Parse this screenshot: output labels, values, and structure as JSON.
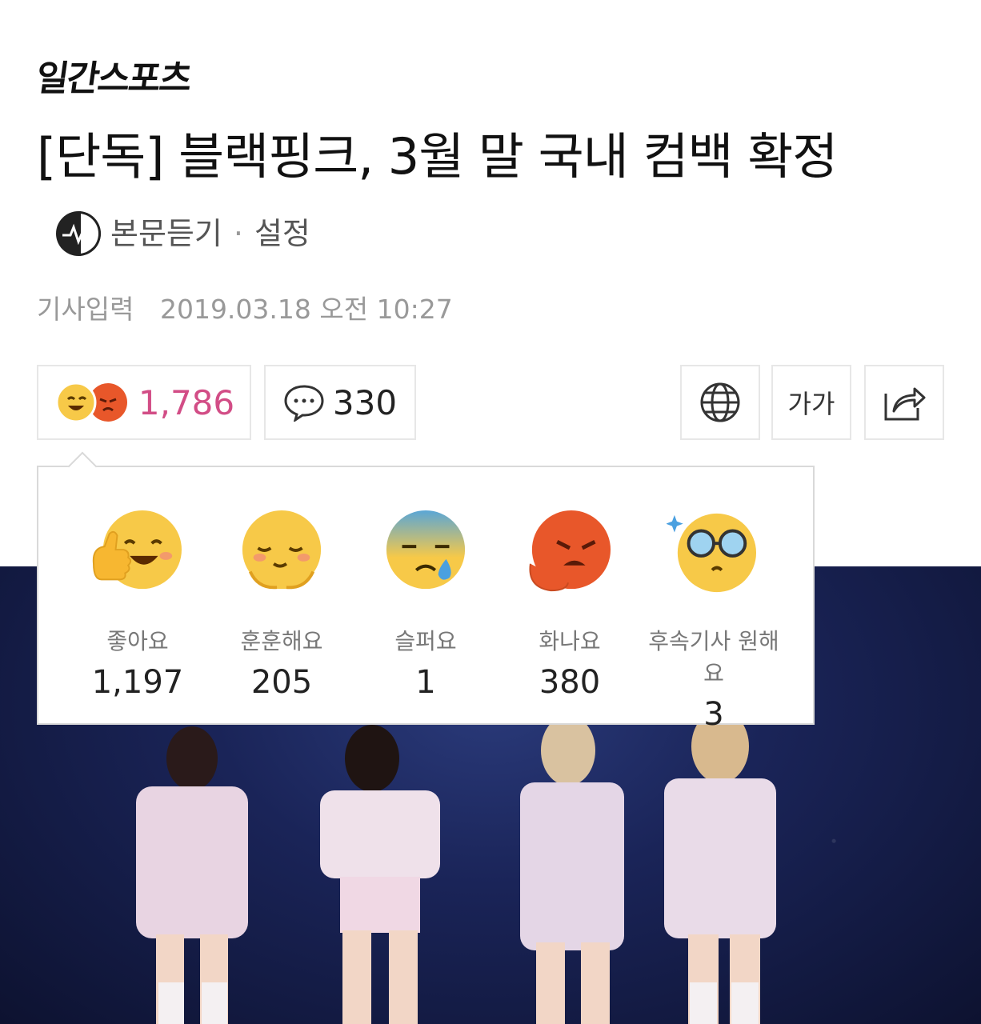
{
  "brand": {
    "logo_text": "일간스포츠"
  },
  "article": {
    "title": "[단독] 블랙핑크, 3월 말 국내 컴백 확정",
    "listen_label": "본문듣기",
    "separator": "·",
    "settings_label": "설정",
    "date_label": "기사입력",
    "date_value": "2019.03.18 오전 10:27"
  },
  "toolbar": {
    "reaction_total": "1,786",
    "comment_count": "330",
    "font_label": "가가"
  },
  "reactions": [
    {
      "label": "좋아요",
      "count": "1,197",
      "icon": "thumbs-up-smile-icon"
    },
    {
      "label": "훈훈해요",
      "count": "205",
      "icon": "warm-smile-icon"
    },
    {
      "label": "슬퍼요",
      "count": "1",
      "icon": "sad-tear-icon"
    },
    {
      "label": "화나요",
      "count": "380",
      "icon": "angry-face-icon"
    },
    {
      "label": "후속기사 원해요",
      "count": "3",
      "icon": "glasses-face-icon"
    }
  ],
  "colors": {
    "accent_pink": "#d24d86",
    "emoji_yellow": "#f7c948",
    "angry_orange": "#e8572a"
  }
}
